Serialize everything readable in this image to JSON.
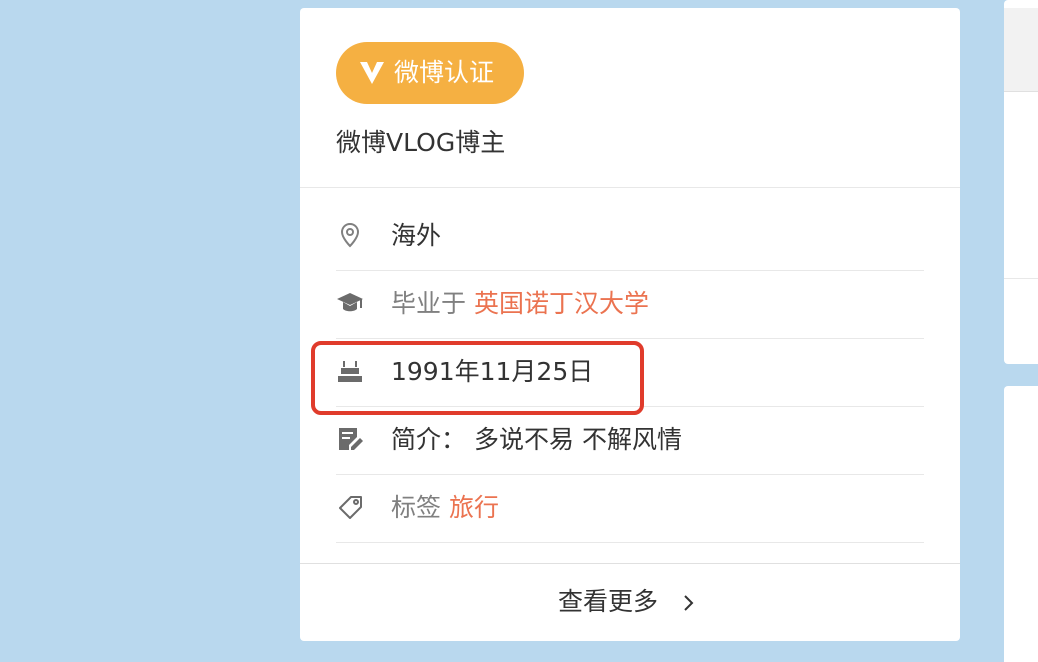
{
  "verification": {
    "badge_label": "微博认证",
    "description": "微博VLOG博主"
  },
  "info": {
    "location": {
      "icon": "location-pin-icon",
      "value": "海外"
    },
    "education": {
      "icon": "graduation-cap-icon",
      "prefix": "毕业于",
      "school": "英国诺丁汉大学"
    },
    "birthday": {
      "icon": "birthday-cake-icon",
      "value": "1991年11月25日"
    },
    "bio": {
      "icon": "edit-note-icon",
      "label": "简介：",
      "value": "多说不易 不解风情"
    },
    "tags": {
      "icon": "tag-icon",
      "label": "标签",
      "value": "旅行"
    }
  },
  "more": {
    "label": "查看更多",
    "icon": "chevron-right-icon"
  },
  "colors": {
    "background": "#b9d8ee",
    "badge": "#f5b042",
    "accent": "#eb7350",
    "highlight_border": "#e03b2b",
    "text": "#333333",
    "muted_text": "#808080"
  }
}
